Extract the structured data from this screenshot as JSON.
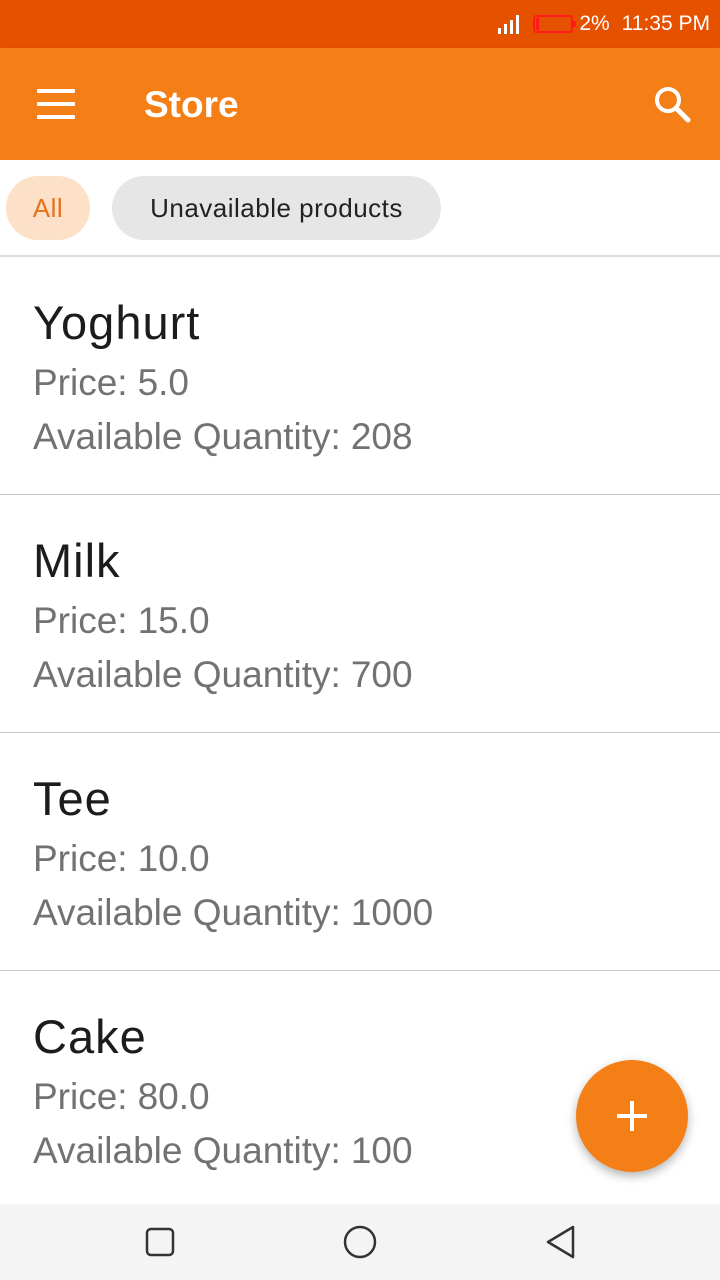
{
  "status_bar": {
    "battery_text": "2%",
    "time": "11:35 PM",
    "battery_level": 0.02,
    "icons": [
      "signal-icon",
      "battery-icon"
    ]
  },
  "app_bar": {
    "title": "Store",
    "icons": [
      "menu-icon",
      "search-icon"
    ]
  },
  "filters": {
    "chips": [
      {
        "label": "All",
        "selected": true
      },
      {
        "label": "Unavailable products",
        "selected": false
      }
    ]
  },
  "products": [
    {
      "name": "Yoghurt",
      "price_label": "Price:",
      "price": "5.0",
      "qty_label": "Available Quantity:",
      "qty": "208"
    },
    {
      "name": "Milk",
      "price_label": "Price:",
      "price": "15.0",
      "qty_label": "Available Quantity:",
      "qty": "700"
    },
    {
      "name": "Tee",
      "price_label": "Price:",
      "price": "10.0",
      "qty_label": "Available Quantity:",
      "qty": "1000"
    },
    {
      "name": "Cake",
      "price_label": "Price:",
      "price": "80.0",
      "qty_label": "Available Quantity:",
      "qty": "100"
    }
  ],
  "fab": {
    "icon": "add-icon"
  },
  "nav_bar": {
    "icons": [
      "recent-apps-icon",
      "home-icon",
      "back-icon"
    ]
  },
  "colors": {
    "status_bar": "#e65100",
    "primary": "#f57f17",
    "chip_selected_bg": "#fde0c8",
    "chip_selected_text": "#e8711a",
    "chip_bg": "#e6e6e6",
    "battery_low": "#ff1a1a"
  }
}
